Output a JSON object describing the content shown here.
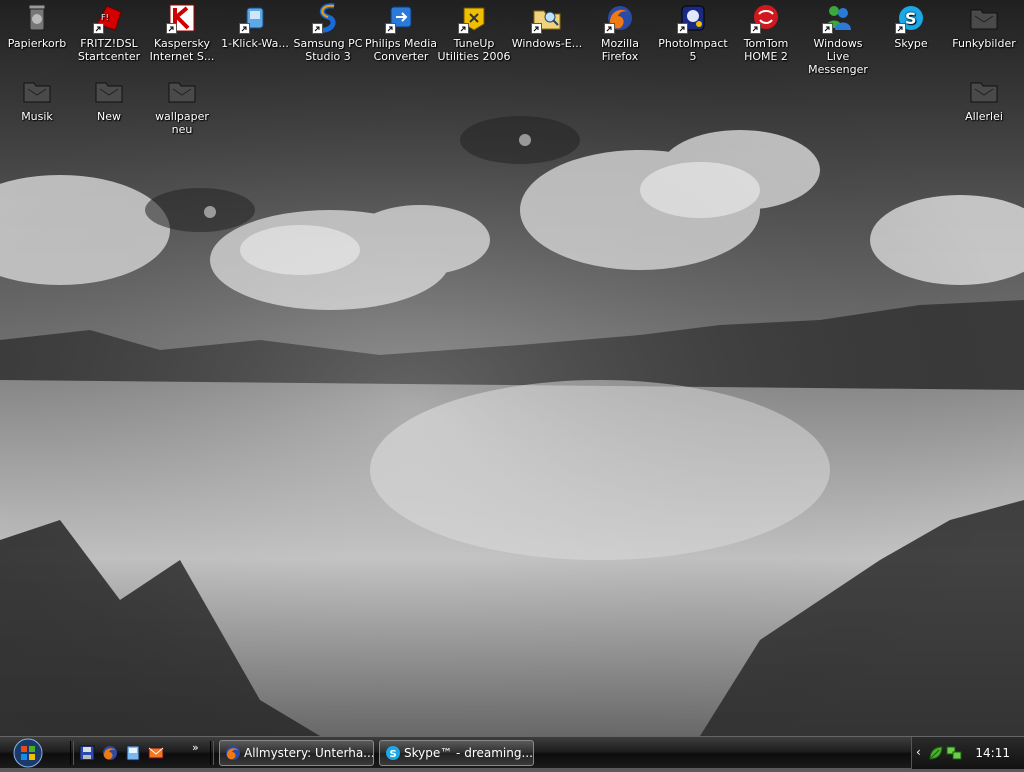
{
  "desktop": {
    "icons_row1": [
      {
        "label": "Papierkorb",
        "icon": "recycle-bin-icon"
      },
      {
        "label": "FRITZ!DSL Startcenter",
        "icon": "fritz-icon"
      },
      {
        "label": "Kaspersky Internet S...",
        "icon": "kaspersky-icon"
      },
      {
        "label": "1-Klick-Wa...",
        "icon": "oneclick-icon"
      },
      {
        "label": "Samsung PC Studio 3",
        "icon": "samsung-icon"
      },
      {
        "label": "Philips Media Converter",
        "icon": "philips-icon"
      },
      {
        "label": "TuneUp Utilities 2006",
        "icon": "tuneup-icon"
      },
      {
        "label": "Windows-E...",
        "icon": "explorer-icon"
      },
      {
        "label": "Mozilla Firefox",
        "icon": "firefox-icon"
      },
      {
        "label": "PhotoImpact 5",
        "icon": "photoimpact-icon"
      },
      {
        "label": "TomTom HOME 2",
        "icon": "tomtom-icon"
      },
      {
        "label": "Windows Live Messenger",
        "icon": "messenger-icon"
      },
      {
        "label": "Skype",
        "icon": "skype-icon"
      },
      {
        "label": "Funkybilder",
        "icon": "folder-icon"
      }
    ],
    "icons_row2": [
      {
        "label": "Musik",
        "icon": "folder-icon"
      },
      {
        "label": "New",
        "icon": "folder-icon"
      },
      {
        "label": "wallpaper neu",
        "icon": "folder-icon"
      },
      {
        "label": "Allerlei",
        "icon": "folder-icon"
      }
    ]
  },
  "taskbar": {
    "start_icon": "start-orb-icon",
    "quick_launch": [
      "save-disk-icon",
      "firefox-icon",
      "explorer-icon",
      "mail-icon"
    ],
    "quick_launch_more": "»",
    "tasks": [
      {
        "label": "Allmystery: Unterha...",
        "icon": "firefox-icon"
      },
      {
        "label": "Skype™ - dreaming...",
        "icon": "skype-icon"
      }
    ],
    "tray": {
      "chevron": "‹",
      "icons": [
        "leaf-icon",
        "network-icon"
      ],
      "clock": "14:11"
    }
  },
  "colors": {
    "taskbar": "#1a1a1a",
    "icon_text": "#ffffff"
  }
}
